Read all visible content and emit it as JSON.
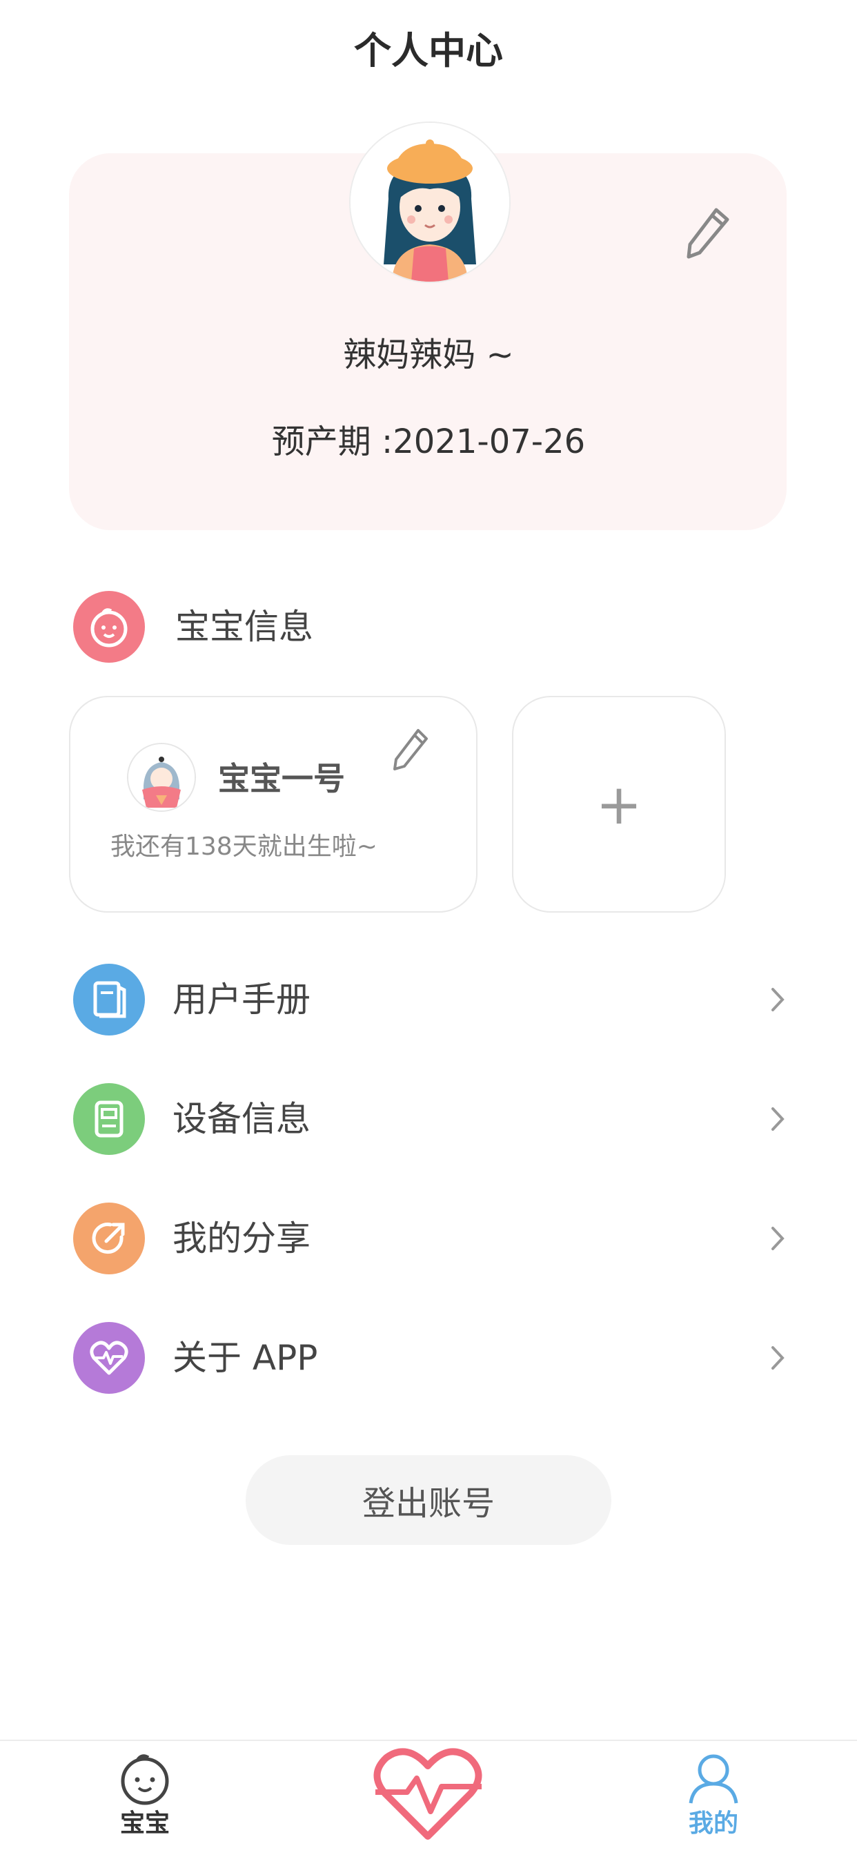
{
  "header": {
    "title": "个人中心"
  },
  "profile": {
    "nickname": "辣妈辣妈 ~",
    "due_date": "预产期 :2021-07-26"
  },
  "baby_section": {
    "label": "宝宝信息",
    "babies": [
      {
        "name": "宝宝一号",
        "countdown": "我还有138天就出生啦~"
      }
    ],
    "add_label": "+"
  },
  "menu": [
    {
      "label": "用户手册",
      "icon": "book-icon",
      "color": "#5aaae4"
    },
    {
      "label": "设备信息",
      "icon": "device-icon",
      "color": "#7ccd7c"
    },
    {
      "label": "我的分享",
      "icon": "share-icon",
      "color": "#f4a46c"
    },
    {
      "label": "关于 APP",
      "icon": "heart-pulse-icon",
      "color": "#b57ad8"
    }
  ],
  "logout": {
    "label": "登出账号"
  },
  "tabbar": {
    "tabs": [
      {
        "label": "宝宝",
        "active": false
      },
      {
        "label": "",
        "icon": "heartbeat-icon",
        "active": false
      },
      {
        "label": "我的",
        "active": true
      }
    ]
  },
  "colors": {
    "card_bg": "#fdf4f4",
    "baby_icon": "#f37b87",
    "heart_tab": "#f06a7c",
    "active_tab": "#5aaae4"
  }
}
